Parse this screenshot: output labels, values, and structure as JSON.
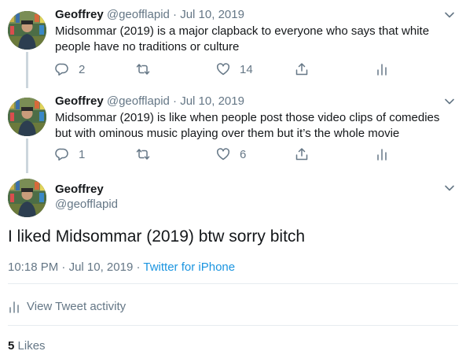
{
  "tweets": [
    {
      "name": "Geoffrey",
      "handle": "@geofflapid",
      "separator": "·",
      "date": "Jul 10, 2019",
      "text": "Midsommar (2019) is a major clapback to everyone who says that white people have no traditions or culture",
      "replies": "2",
      "retweets": "",
      "likes": "14"
    },
    {
      "name": "Geoffrey",
      "handle": "@geofflapid",
      "separator": "·",
      "date": "Jul 10, 2019",
      "text": "Midsommar (2019) is like when people post those video clips of comedies but with ominous music playing over them but it’s the whole movie",
      "replies": "1",
      "retweets": "",
      "likes": "6"
    }
  ],
  "main": {
    "name": "Geoffrey",
    "handle": "@geofflapid",
    "text": "I liked Midsommar (2019) btw sorry bitch",
    "time": "10:18 PM",
    "separator": "·",
    "date": "Jul 10, 2019",
    "separator2": "·",
    "source": "Twitter for iPhone",
    "activity_label": "View Tweet activity",
    "likes_count": "5",
    "likes_label": "Likes"
  },
  "icons": {
    "reply": "reply-icon",
    "retweet": "retweet-icon",
    "like": "heart-icon",
    "share": "share-icon",
    "analytics": "analytics-icon",
    "caret": "chevron-down-icon"
  },
  "colors": {
    "text": "#14171a",
    "muted": "#657786",
    "link": "#1b95e0",
    "thread_line": "#ccd6dd",
    "divider": "#e6ecf0"
  }
}
